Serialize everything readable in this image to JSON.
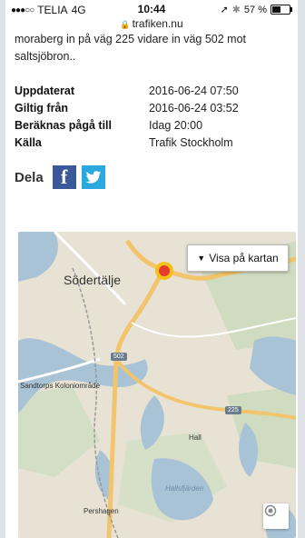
{
  "status_bar": {
    "carrier": "TELIA",
    "network": "4G",
    "time": "10:44",
    "battery_percent": "57 %",
    "battery_level": 0.57
  },
  "browser": {
    "url": "trafiken.nu"
  },
  "article": {
    "description": "moraberg in på väg 225 vidare in väg 502 mot saltsjöbron..",
    "meta": [
      {
        "label": "Uppdaterat",
        "value": "2016-06-24 07:50"
      },
      {
        "label": "Giltig från",
        "value": "2016-06-24 03:52"
      },
      {
        "label": "Beräknas pågå till",
        "value": "Idag 20:00"
      },
      {
        "label": "Källa",
        "value": "Trafik Stockholm"
      }
    ]
  },
  "share": {
    "label": "Dela",
    "facebook_icon": "f",
    "twitter_icon": "twitter-bird"
  },
  "map": {
    "view_on_map_label": "Visa på kartan",
    "labels": {
      "city": "Södertälje",
      "area1": "Sandtorps Koloniområde",
      "area2": "Hall",
      "area3": "Pershagen",
      "lake": "Hallsfjärden"
    },
    "road_shields": {
      "r1": "502",
      "r2": "225"
    },
    "colors": {
      "water": "#a9c3d6",
      "land": "#e8e2d4",
      "forest": "#cfdcc0",
      "road": "#f2c46b",
      "marker": "#e53b2c"
    }
  }
}
